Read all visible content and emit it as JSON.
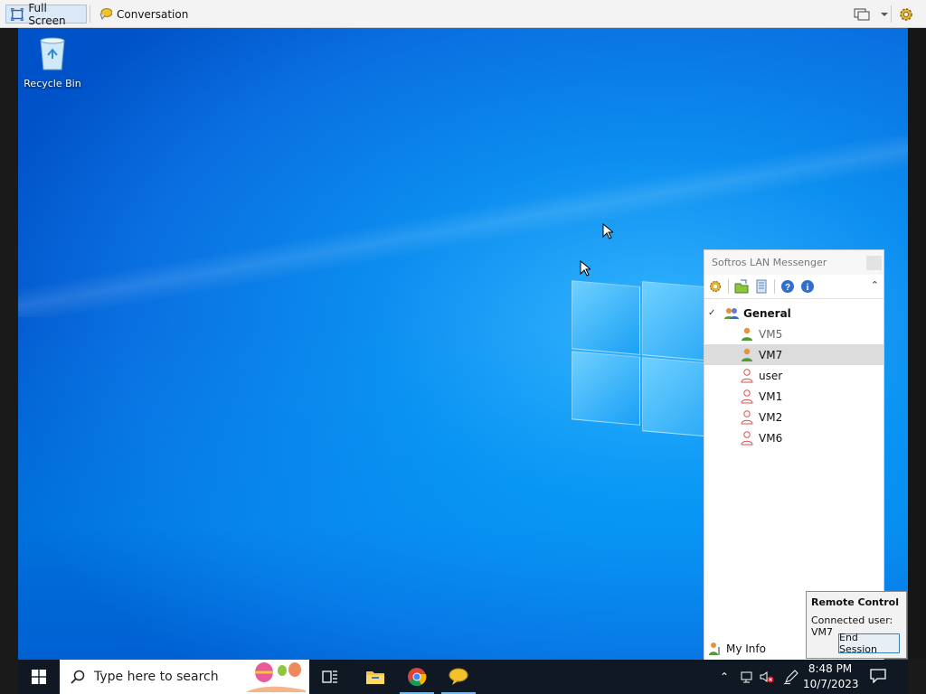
{
  "toolbar": {
    "full_screen_label": "Full Screen",
    "conversation_label": "Conversation"
  },
  "desktop": {
    "recycle_bin_label": "Recycle Bin"
  },
  "messenger": {
    "title": "Softros LAN Messenger",
    "group_name": "General",
    "users": [
      {
        "name": "VM5",
        "status": "online-dim"
      },
      {
        "name": "VM7",
        "status": "online",
        "selected": true
      },
      {
        "name": "user",
        "status": "offline"
      },
      {
        "name": "VM1",
        "status": "offline"
      },
      {
        "name": "VM2",
        "status": "offline"
      },
      {
        "name": "VM6",
        "status": "offline"
      }
    ],
    "my_info_label": "My Info"
  },
  "remote_control": {
    "title": "Remote Control",
    "connected_label": "Connected user: VM7",
    "end_session_label": "End Session"
  },
  "taskbar": {
    "search_placeholder": "Type here to search",
    "time": "8:48 PM",
    "date": "10/7/2023"
  },
  "colors": {
    "accent": "#0a78e8",
    "taskbar": "#0f1823",
    "selection": "#dcdcdc"
  }
}
